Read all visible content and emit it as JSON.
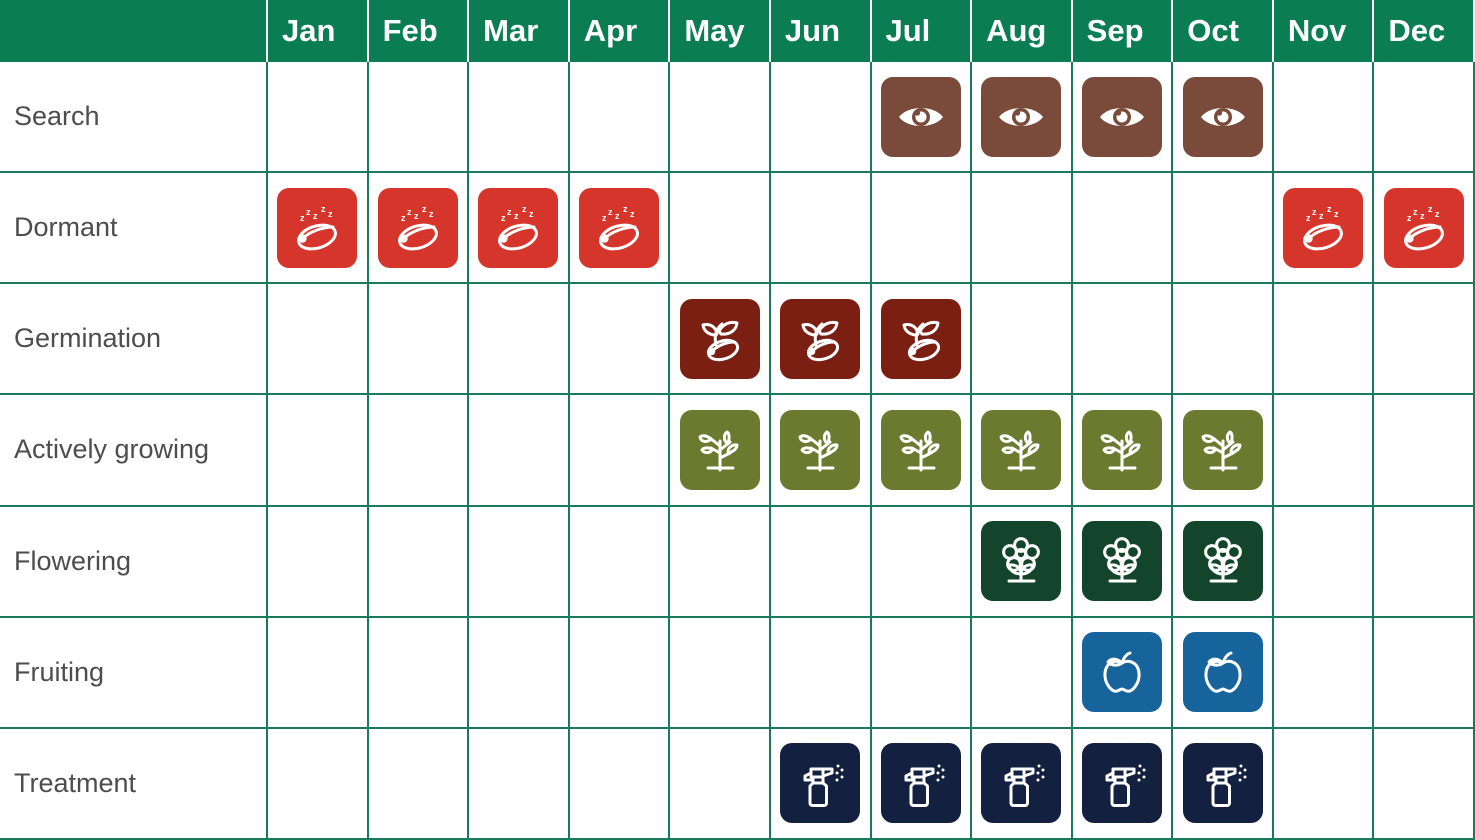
{
  "header": {
    "corner_label": "",
    "months": [
      "Jan",
      "Feb",
      "Mar",
      "Apr",
      "May",
      "Jun",
      "Jul",
      "Aug",
      "Sep",
      "Oct",
      "Nov",
      "Dec"
    ]
  },
  "colors": {
    "header_green": "#0a7d52",
    "grid_line": "#1b7a58",
    "row_label_text": "#4d4d4d",
    "search": "#7a4b3a",
    "dormant": "#d6352b",
    "germination": "#7b1f12",
    "actively_growing": "#6b7a2e",
    "flowering": "#12452b",
    "fruiting": "#17639b",
    "treatment": "#14203f",
    "icon_stroke": "#ffffff"
  },
  "rows": [
    {
      "label": "Search",
      "icon": "eye-icon",
      "color": "#7a4b3a",
      "months": [
        false,
        false,
        false,
        false,
        false,
        false,
        true,
        true,
        true,
        true,
        false,
        false
      ]
    },
    {
      "label": "Dormant",
      "icon": "sleeping-seed-icon",
      "color": "#d6352b",
      "months": [
        true,
        true,
        true,
        true,
        false,
        false,
        false,
        false,
        false,
        false,
        true,
        true
      ]
    },
    {
      "label": "Germination",
      "icon": "sprouting-seed-icon",
      "color": "#7b1f12",
      "months": [
        false,
        false,
        false,
        false,
        true,
        true,
        true,
        false,
        false,
        false,
        false,
        false
      ]
    },
    {
      "label": "Actively growing",
      "icon": "seedling-plant-icon",
      "color": "#6b7a2e",
      "months": [
        false,
        false,
        false,
        false,
        true,
        true,
        true,
        true,
        true,
        true,
        false,
        false
      ]
    },
    {
      "label": "Flowering",
      "icon": "flower-icon",
      "color": "#12452b",
      "months": [
        false,
        false,
        false,
        false,
        false,
        false,
        false,
        true,
        true,
        true,
        false,
        false
      ]
    },
    {
      "label": "Fruiting",
      "icon": "apple-fruit-icon",
      "color": "#17639b",
      "months": [
        false,
        false,
        false,
        false,
        false,
        false,
        false,
        false,
        true,
        true,
        false,
        false
      ]
    },
    {
      "label": "Treatment",
      "icon": "spray-bottle-icon",
      "color": "#14203f",
      "months": [
        false,
        false,
        false,
        false,
        false,
        true,
        true,
        true,
        true,
        true,
        false,
        false
      ]
    }
  ],
  "chart_data": {
    "type": "heatmap",
    "title": "",
    "xlabel": "",
    "ylabel": "",
    "categories": [
      "Jan",
      "Feb",
      "Mar",
      "Apr",
      "May",
      "Jun",
      "Jul",
      "Aug",
      "Sep",
      "Oct",
      "Nov",
      "Dec"
    ],
    "series": [
      {
        "name": "Search",
        "values": [
          0,
          0,
          0,
          0,
          0,
          0,
          1,
          1,
          1,
          1,
          0,
          0
        ]
      },
      {
        "name": "Dormant",
        "values": [
          1,
          1,
          1,
          1,
          0,
          0,
          0,
          0,
          0,
          0,
          1,
          1
        ]
      },
      {
        "name": "Germination",
        "values": [
          0,
          0,
          0,
          0,
          1,
          1,
          1,
          0,
          0,
          0,
          0,
          0
        ]
      },
      {
        "name": "Actively growing",
        "values": [
          0,
          0,
          0,
          0,
          1,
          1,
          1,
          1,
          1,
          1,
          0,
          0
        ]
      },
      {
        "name": "Flowering",
        "values": [
          0,
          0,
          0,
          0,
          0,
          0,
          0,
          1,
          1,
          1,
          0,
          0
        ]
      },
      {
        "name": "Fruiting",
        "values": [
          0,
          0,
          0,
          0,
          0,
          0,
          0,
          0,
          1,
          1,
          0,
          0
        ]
      },
      {
        "name": "Treatment",
        "values": [
          0,
          0,
          0,
          0,
          0,
          1,
          1,
          1,
          1,
          1,
          0,
          0
        ]
      }
    ],
    "legend": []
  }
}
